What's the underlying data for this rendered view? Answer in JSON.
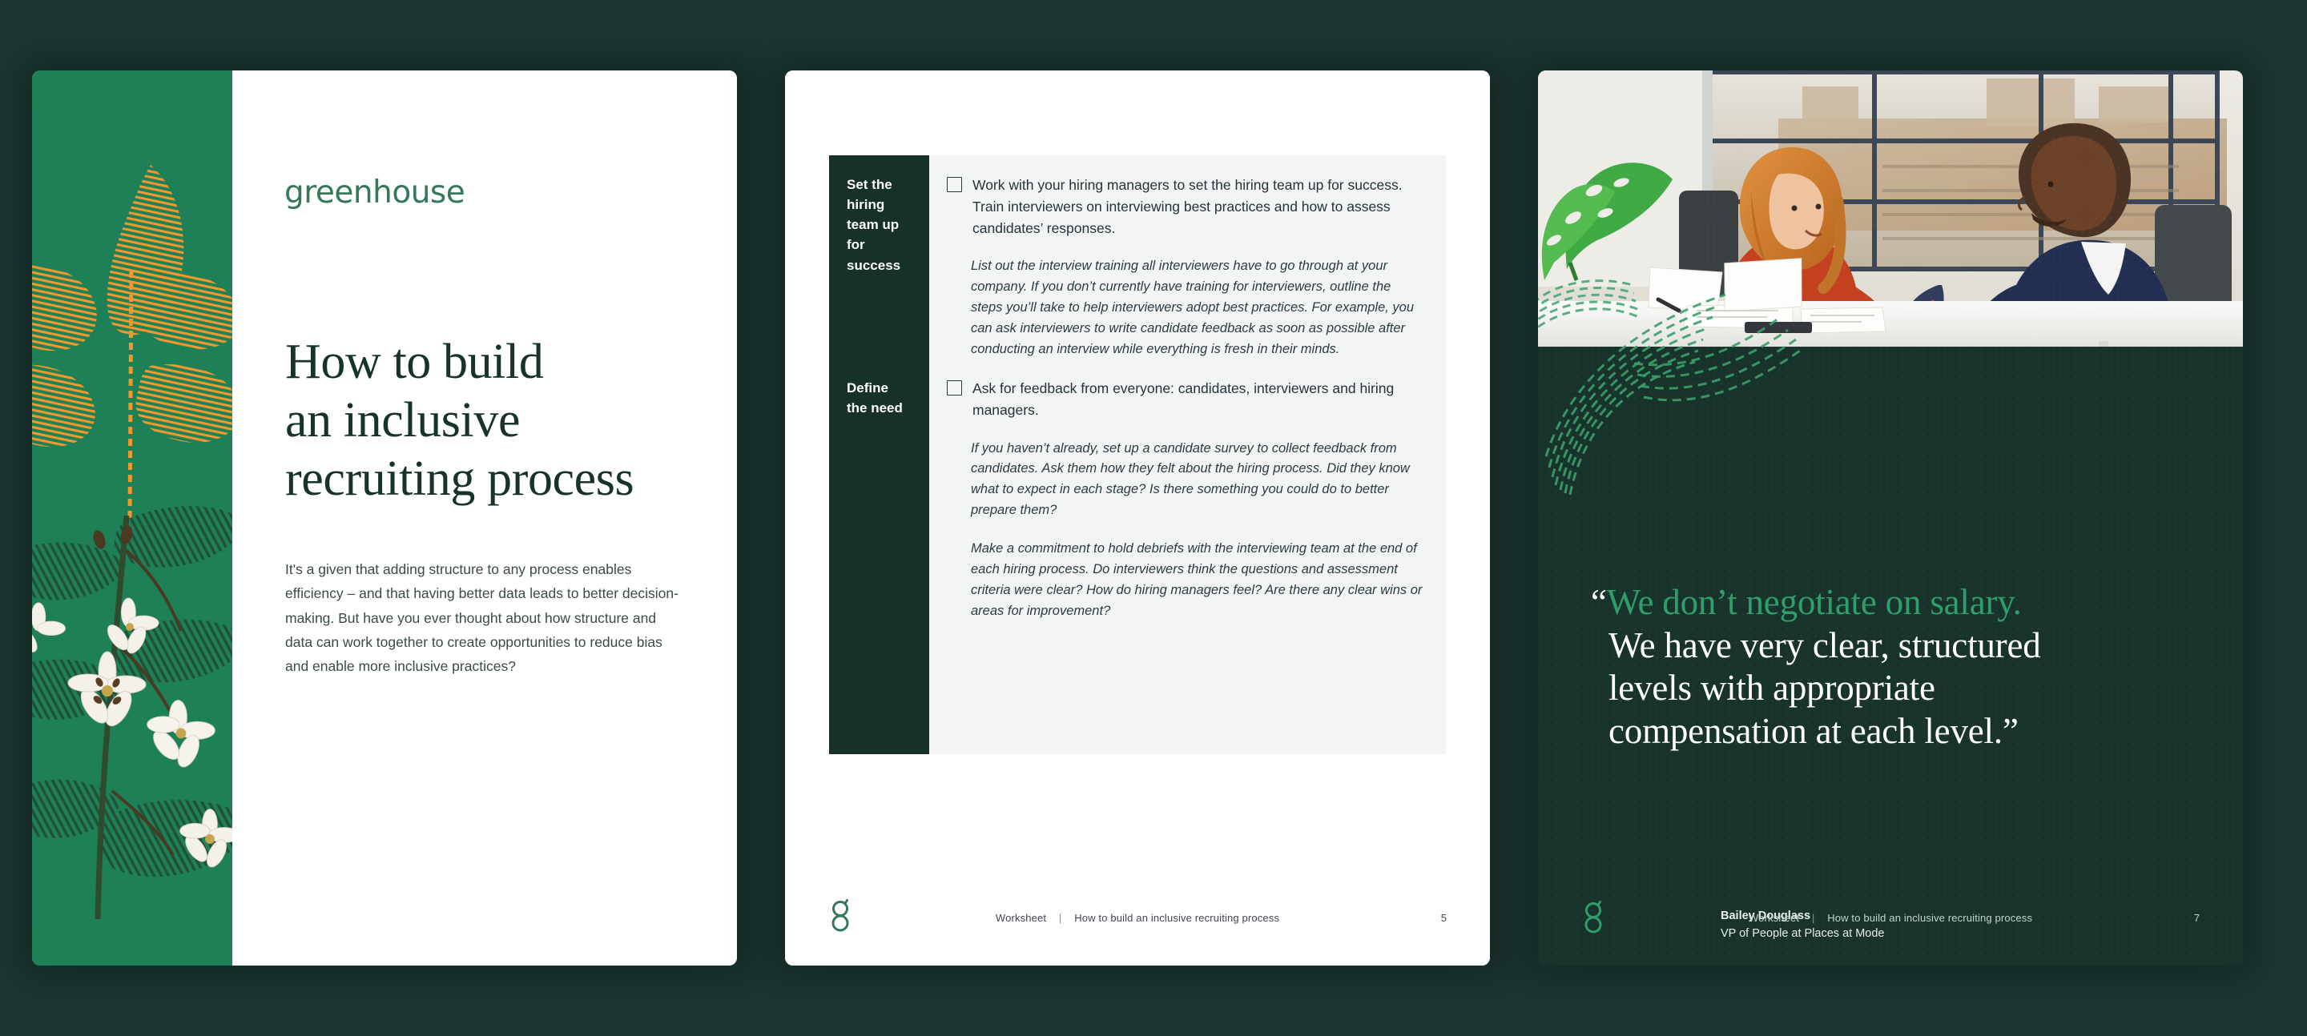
{
  "document": {
    "brand": "greenhouse",
    "brand_color": "#35795a",
    "accent_green": "#2f9e6b",
    "panel_dark": "#16302a",
    "page_green": "#1d8057",
    "backdrop": "#1e3631",
    "footer_label": "Worksheet",
    "footer_separator": "|",
    "footer_title": "How to build an inclusive recruiting process"
  },
  "page1": {
    "logo": "greenhouse",
    "title_lines": [
      "How to build",
      "an inclusive",
      "recruiting process"
    ],
    "intro": "It's a given that adding structure to any process enables efficiency – and that having better data leads to better decision-making. But have you ever thought about how structure and data can work together to create opportunities to reduce bias and enable more inclusive practices?",
    "artwork": "botanical-fingerprint-illustration"
  },
  "page2": {
    "sections": [
      {
        "label_lines": [
          "Set the hiring",
          "team up for",
          "success"
        ],
        "checkbox_checked": false,
        "checkbox_text": "Work with your hiring managers to set the hiring team up for success. Train interviewers on interviewing best practices and how to assess candidates’ responses.",
        "notes": [
          "List out the interview training all interviewers have to go through at your company. If you don’t currently have training for interviewers, outline the steps you’ll take to help interviewers adopt best practices. For example, you can ask interviewers to write candidate feedback as soon as possible after conducting an interview while everything is fresh in their minds."
        ]
      },
      {
        "label_lines": [
          "Define",
          "the need"
        ],
        "checkbox_checked": false,
        "checkbox_text": "Ask for feedback from everyone: candidates, interviewers and hiring managers.",
        "notes": [
          "If you haven’t already, set up a candidate survey to collect feedback from candidates. Ask them how they felt about the hiring process. Did they know what to expect in each stage? Is there something you could do to better prepare them?",
          "Make a commitment to hold debriefs with the interviewing team at the end of each hiring process. Do interviewers think the questions and assessment criteria were clear? How do hiring managers feel? Are there any clear wins or areas for improvement?"
        ]
      }
    ],
    "footer": {
      "label": "Worksheet",
      "separator": "|",
      "title": "How to build an inclusive recruiting process",
      "page_number": "5"
    }
  },
  "page3": {
    "photo_alt": "two-colleagues-at-desk-photo",
    "quote": {
      "open_mark": "“",
      "highlight_line": "We don’t negotiate on salary.",
      "rest_lines": [
        "We have very clear, structured",
        "levels with appropriate",
        "compensation at each level.”"
      ]
    },
    "attribution": {
      "name": "Bailey Douglass",
      "role": "VP of People at Places at Mode"
    },
    "footer": {
      "label": "Worksheet",
      "separator": "|",
      "title": "How to build an inclusive recruiting process",
      "page_number": "7"
    }
  }
}
